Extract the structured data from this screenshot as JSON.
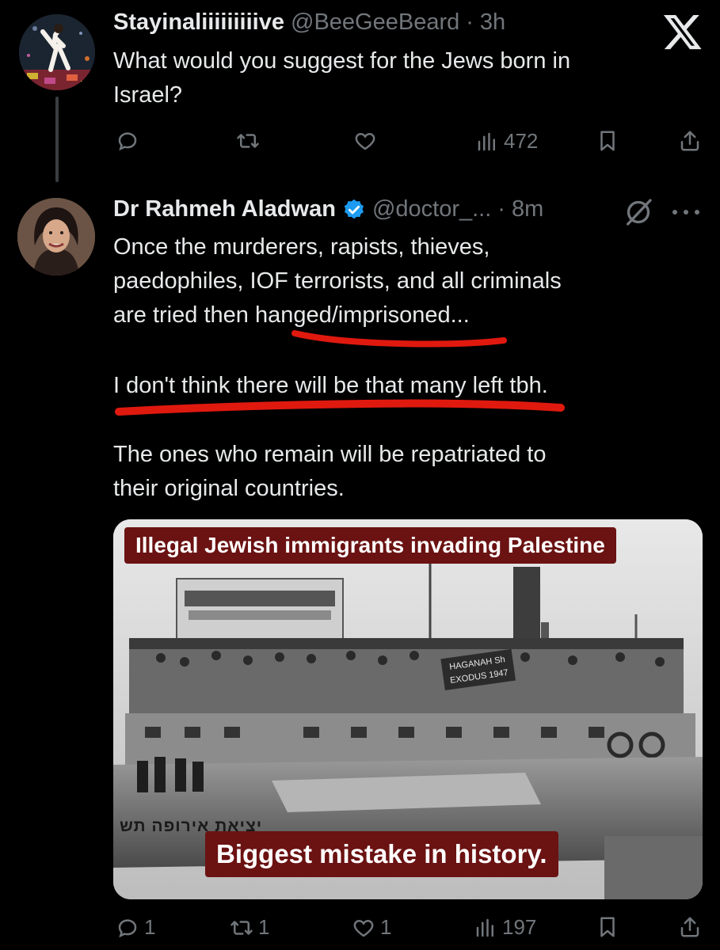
{
  "window": {
    "close_icon": "x-logo-icon"
  },
  "tweet_parent": {
    "display_name": "Stayinaliiiiiiiiive",
    "handle": "@BeeGeeBeard",
    "separator": "·",
    "time": "3h",
    "text_lines": [
      "What would you suggest for the Jews born in",
      "Israel?"
    ],
    "actions": {
      "reply_count": "",
      "retweet_count": "",
      "like_count": "",
      "views": "472"
    }
  },
  "tweet_reply": {
    "display_name": "Dr Rahmeh Aladwan",
    "verified": true,
    "handle": "@doctor_...",
    "separator": "·",
    "time": "8m",
    "paragraph1": [
      "Once the murderers, rapists, thieves,",
      "paedophiles, IOF terrorists, and all criminals",
      "are tried then hanged/imprisoned..."
    ],
    "paragraph2": "I don't think there will be that many left tbh.",
    "paragraph3": [
      "The ones who remain will be repatriated to",
      "their original countries."
    ],
    "media": {
      "caption_top": "Illegal Jewish immigrants invading Palestine",
      "caption_bottom": "Biggest mistake in history.",
      "hull_text": "יציאת אירופה תש",
      "banner_text": [
        "HAGANAH Sh",
        "EXODUS 1947"
      ]
    },
    "actions": {
      "reply_count": "1",
      "retweet_count": "1",
      "like_count": "1",
      "views": "197"
    }
  },
  "annotation_color": "#e0190f",
  "accent_verified": "#1d9bf0"
}
